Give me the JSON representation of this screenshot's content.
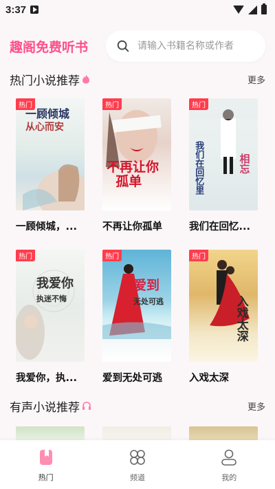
{
  "status": {
    "time": "3:37"
  },
  "app": {
    "title": "趣阁免费听书"
  },
  "search": {
    "placeholder": "请输入书籍名称或作者"
  },
  "sections": {
    "hot": {
      "title": "热门小说推荐",
      "more": "更多",
      "books": [
        {
          "title": "一顾倾城，...",
          "badge": "热门",
          "cover_text": "一顾倾城\n从心而安",
          "accent": "#b23b3b"
        },
        {
          "title": "不再让你孤单",
          "badge": "热门",
          "cover_text": "不再让你\n孤单",
          "accent": "#d4142a"
        },
        {
          "title": "我们在回忆...",
          "badge": "热门",
          "cover_text": "我们在回忆里\n相忘",
          "accent": "#2a3f7a"
        },
        {
          "title": "我爱你，执...",
          "badge": "热门",
          "cover_text": "我爱你\n执迷不悔",
          "accent": "#3a3a3a"
        },
        {
          "title": "爱到无处可逃",
          "badge": "热门",
          "cover_text": "爱到\n无处可逃",
          "accent": "#d62242"
        },
        {
          "title": "入戏太深",
          "badge": "热门",
          "cover_text": "入戏\n太深",
          "accent": "#2b2b2b"
        }
      ]
    },
    "audio": {
      "title": "有声小说推荐",
      "more": "更多"
    }
  },
  "nav": [
    {
      "label": "热门",
      "icon": "bookmark-book-icon",
      "active": true
    },
    {
      "label": "频道",
      "icon": "four-circles-icon",
      "active": false
    },
    {
      "label": "我的",
      "icon": "user-icon",
      "active": false
    }
  ],
  "colors": {
    "brand": "#ff4f8b",
    "badge": "#ff3d4d"
  }
}
